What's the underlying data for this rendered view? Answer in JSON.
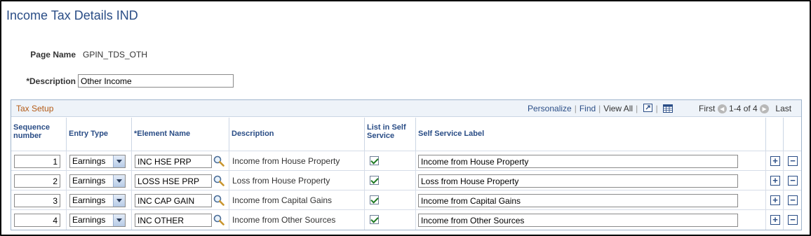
{
  "page": {
    "title": "Income Tax Details IND",
    "page_name_label": "Page Name",
    "page_name_value": "GPIN_TDS_OTH",
    "description_label": "*Description",
    "description_value": "Other Income"
  },
  "grid": {
    "title": "Tax Setup",
    "personalize": "Personalize",
    "find": "Find",
    "view_all": "View All",
    "first": "First",
    "range": "1-4 of 4",
    "last": "Last",
    "columns": {
      "sequence": "Sequence number",
      "entry_type": "Entry Type",
      "element_name": "*Element Name",
      "description": "Description",
      "list_in_self_service": "List in Self Service",
      "self_service_label": "Self Service Label"
    },
    "rows": [
      {
        "seq": "1",
        "entry_type": "Earnings",
        "element": "INC HSE PRP",
        "description": "Income from House Property",
        "listed": true,
        "label": "Income from House Property"
      },
      {
        "seq": "2",
        "entry_type": "Earnings",
        "element": "LOSS HSE PRP",
        "description": "Loss from House Property",
        "listed": true,
        "label": "Loss from House Property"
      },
      {
        "seq": "3",
        "entry_type": "Earnings",
        "element": "INC CAP GAIN",
        "description": "Income from Capital Gains",
        "listed": true,
        "label": "Income from Capital Gains"
      },
      {
        "seq": "4",
        "entry_type": "Earnings",
        "element": "INC OTHER",
        "description": "Income from Other Sources",
        "listed": true,
        "label": "Income from Other Sources"
      }
    ],
    "icons": [
      "zoom-icon",
      "spreadsheet-icon",
      "lookup-icon",
      "add-row-icon",
      "delete-row-icon"
    ]
  },
  "colors": {
    "title": "#2a4d86",
    "grid_title": "#b35a16",
    "header_bg": "#eef3f9"
  }
}
